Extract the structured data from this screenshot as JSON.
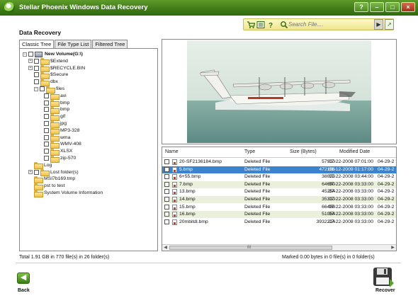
{
  "window": {
    "title": "Stellar Phoenix Windows Data Recovery",
    "controls": [
      "?",
      "–",
      "□",
      "×"
    ]
  },
  "section_title": "Data Recovery",
  "toolbar": {
    "search_placeholder": "Search File....",
    "go_symbol": "▶",
    "export_symbol": "↗",
    "icons": [
      "cart-icon",
      "list-icon",
      "help-icon",
      "search-icon"
    ]
  },
  "tabs": [
    "Classic Tree",
    "File Type List",
    "Filtered Tree"
  ],
  "tree": [
    {
      "label": "New Volume(G:\\)",
      "kind": "drive",
      "expander": "−"
    },
    {
      "label": "$Extend",
      "kind": "folder",
      "expander": "+"
    },
    {
      "label": "$RECYCLE.BIN",
      "kind": "folder",
      "expander": "+"
    },
    {
      "label": "$Secure",
      "kind": "folder",
      "expander": ""
    },
    {
      "label": "dbx",
      "kind": "folder",
      "expander": ""
    },
    {
      "label": "files",
      "kind": "folder",
      "expander": "−"
    },
    {
      "label": "avi",
      "kind": "folder",
      "expander": ""
    },
    {
      "label": "bmp",
      "kind": "folder",
      "expander": ""
    },
    {
      "label": "bmp",
      "kind": "folder",
      "expander": ""
    },
    {
      "label": "gif",
      "kind": "folder",
      "expander": ""
    },
    {
      "label": "jpg",
      "kind": "folder",
      "expander": ""
    },
    {
      "label": "MP3-328",
      "kind": "folder",
      "expander": ""
    },
    {
      "label": "wma",
      "kind": "folder",
      "expander": ""
    },
    {
      "label": "WMV-408",
      "kind": "folder",
      "expander": ""
    },
    {
      "label": "XLSX",
      "kind": "folder",
      "expander": ""
    },
    {
      "label": "zip-570",
      "kind": "folder",
      "expander": ""
    },
    {
      "label": "Log",
      "kind": "folder",
      "expander": ""
    },
    {
      "label": "Lost folder(s)",
      "kind": "folder",
      "expander": "+"
    },
    {
      "label": "MSI7b169.tmp",
      "kind": "folder",
      "expander": ""
    },
    {
      "label": "pst to test",
      "kind": "folder",
      "expander": ""
    },
    {
      "label": "System Volume Information",
      "kind": "folder",
      "expander": ""
    }
  ],
  "filelist": {
    "columns": [
      "Name",
      "Type",
      "Size (Bytes)",
      "Modified Date",
      ""
    ],
    "rows": [
      {
        "name": "20-SF2136184.bmp",
        "type": "Deleted File",
        "size": "57910",
        "modified": "07-22-2008 07:01:00",
        "extra": "04-29-2"
      },
      {
        "name": "5.bmp",
        "type": "Deleted File",
        "size": "472196",
        "modified": "01-12-2009 01:17:00",
        "extra": "04-29-2"
      },
      {
        "name": "6+55.bmp",
        "type": "Deleted File",
        "size": "38022",
        "modified": "07-22-2008 03:44:00",
        "extra": "04-29-2"
      },
      {
        "name": "7.bmp",
        "type": "Deleted File",
        "size": "64690",
        "modified": "07-22-2008 03:33:00",
        "extra": "04-29-2"
      },
      {
        "name": "13.bmp",
        "type": "Deleted File",
        "size": "45254",
        "modified": "07-22-2008 03:33:00",
        "extra": "04-29-2"
      },
      {
        "name": "14.bmp",
        "type": "Deleted File",
        "size": "35310",
        "modified": "07-22-2008 03:33:00",
        "extra": "04-29-2"
      },
      {
        "name": "15.bmp",
        "type": "Deleted File",
        "size": "66498",
        "modified": "07-22-2008 03:33:00",
        "extra": "04-29-2"
      },
      {
        "name": "16.bmp",
        "type": "Deleted File",
        "size": "51054",
        "modified": "07-22-2008 03:33:00",
        "extra": "04-29-2"
      },
      {
        "name": "20mbitdl.bmp",
        "type": "Deleted File",
        "size": "3932214",
        "modified": "07-22-2008 03:33:00",
        "extra": "04-29-2"
      }
    ],
    "selected_index": 1,
    "scroll_left": "◀",
    "scroll_mid": "III",
    "scroll_right": "▶"
  },
  "status": {
    "left": "Total 1.91 GB in 770 file(s) in 26 folder(s)",
    "right": "Marked 0.00 bytes in 0 file(s) in 0 folder(s)"
  },
  "nav": {
    "back_symbol": "◀",
    "back_label": "Back",
    "recover_label": "Recover"
  },
  "colors": {
    "titlebar": "#3f7a17",
    "selection": "#3b83cf",
    "alt_row": "#e9f0dc",
    "toolbar": "#f4ecaa"
  }
}
